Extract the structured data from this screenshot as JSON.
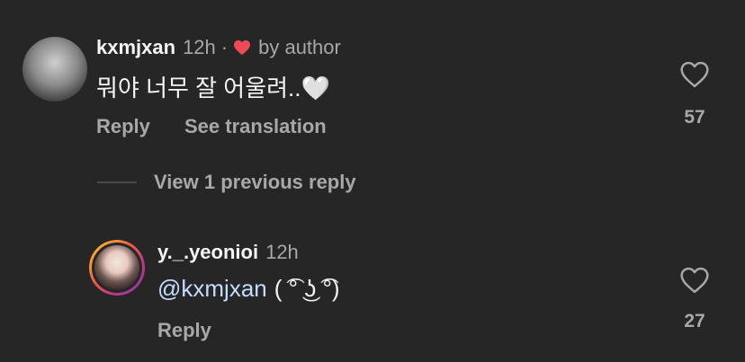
{
  "comment": {
    "username": "kxmjxan",
    "time": "12h",
    "separator": "·",
    "author_badge": "by author",
    "text": "뭐야 너무 잘 어울려..🤍",
    "actions": {
      "reply": "Reply",
      "translate": "See translation"
    },
    "likes": "57"
  },
  "view_replies": "View 1 previous reply",
  "reply": {
    "username": "y._.yeonioi",
    "time": "12h",
    "mention": "@kxmjxan",
    "text": "( ͡° ͜ʖ ͡°)",
    "actions": {
      "reply": "Reply"
    },
    "likes": "27"
  },
  "colors": {
    "background": "#262626",
    "primary_text": "#f5f5f5",
    "secondary_text": "#a8a8a8",
    "mention": "#c5dcff",
    "heart_red": "#ed4956"
  },
  "icons": {
    "author_heart": "heart-filled-icon",
    "like": "heart-outline-icon"
  }
}
